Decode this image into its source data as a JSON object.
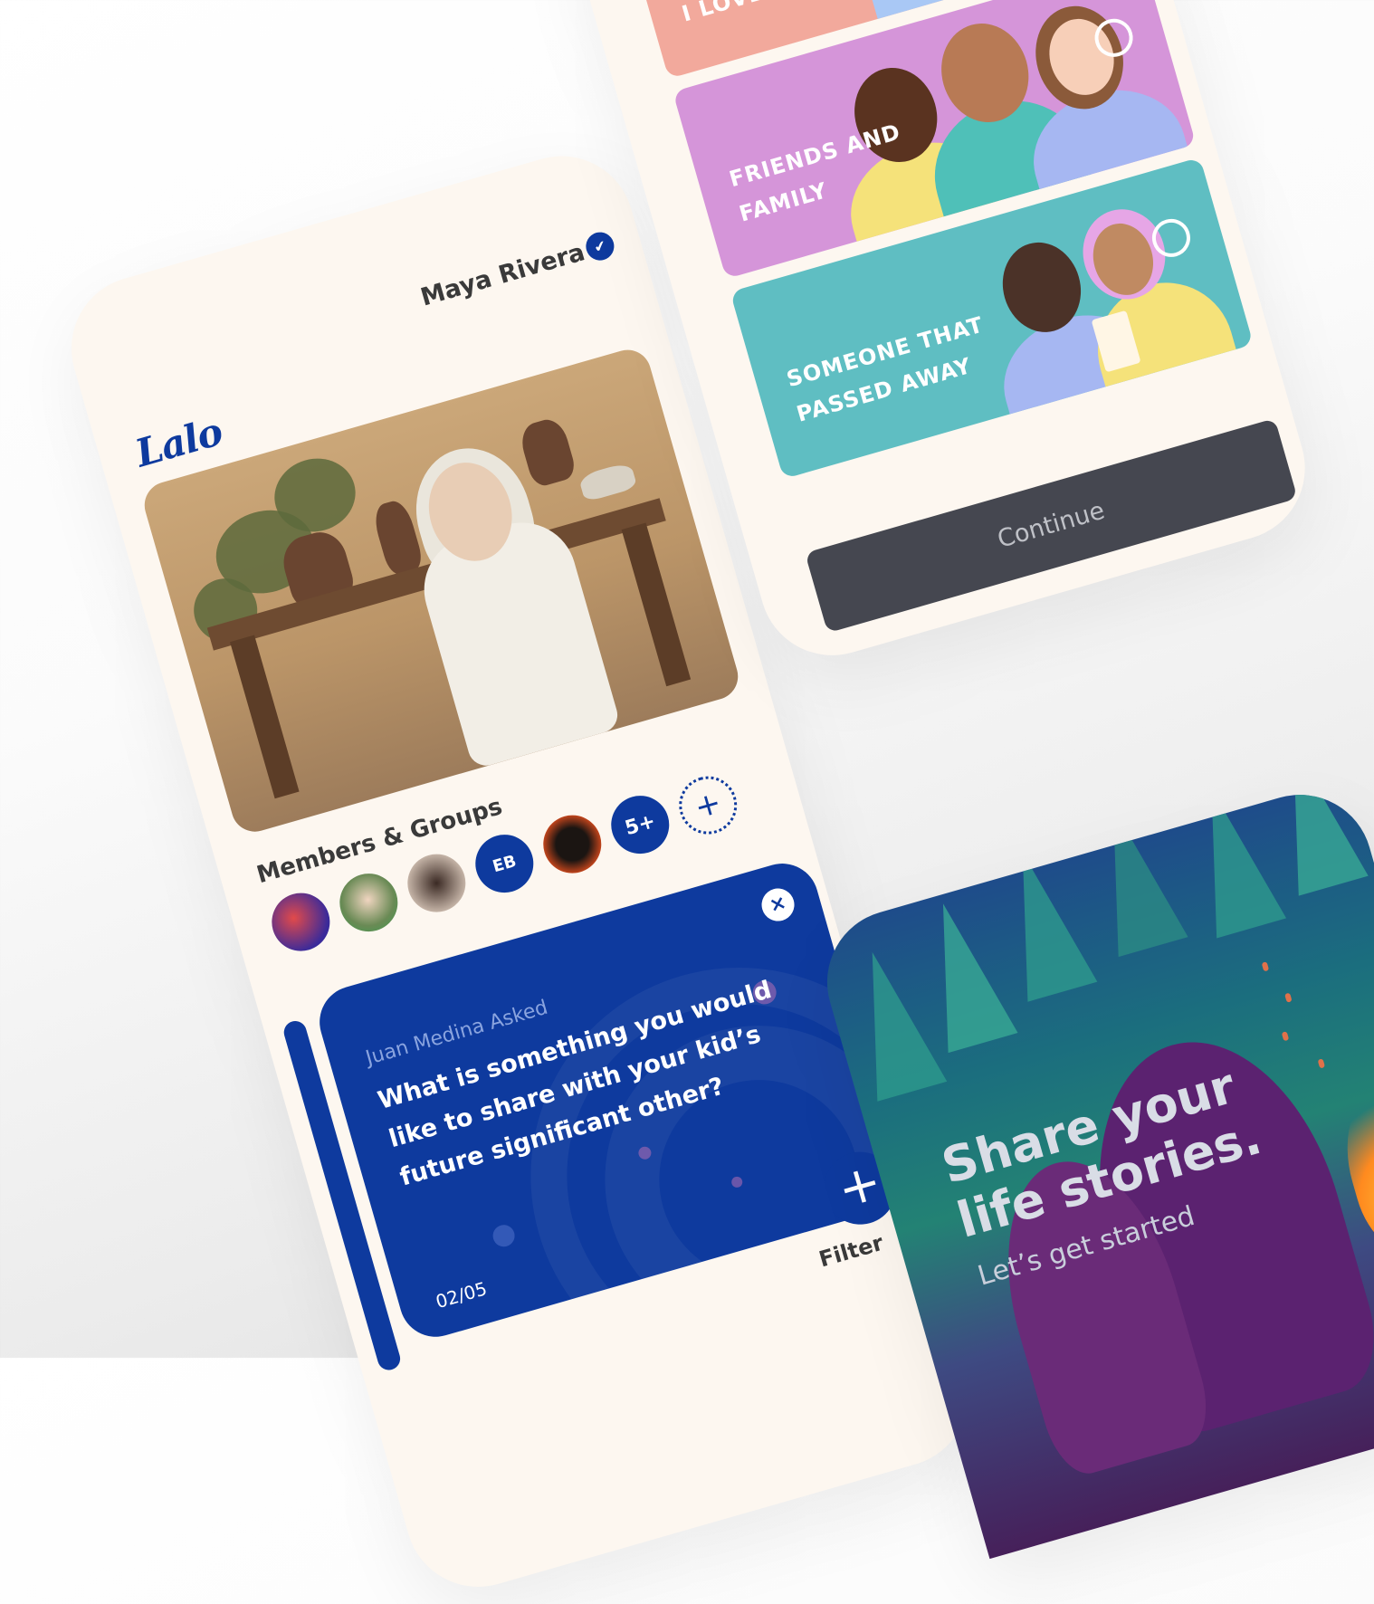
{
  "profile": {
    "name": "Maya Rivera",
    "verified_icon": "✔",
    "logo": "Lalo"
  },
  "members": {
    "title": "Members & Groups",
    "initials": "EB",
    "more_count": "5+",
    "add_icon": "+"
  },
  "question_card": {
    "asker": "Juan Medina Asked",
    "question": "What is something you would like to share with your kid’s future significant other?",
    "close_icon": "×",
    "pager": "02/05"
  },
  "actions": {
    "fab_icon": "+",
    "filter_label": "Filter"
  },
  "categories": [
    {
      "label": "I LOVE"
    },
    {
      "label": "FRIENDS AND FAMILY"
    },
    {
      "label": "SOMEONE THAT PASSED AWAY"
    }
  ],
  "continue_label": "Continue",
  "onboarding": {
    "headline": "Share your life stories.",
    "subline": "Let’s get started"
  },
  "colors": {
    "brand_blue": "#0e3a9e",
    "cream": "#fdf7f0",
    "button_dark": "#454750",
    "salmon": "#f2a99c",
    "lilac": "#d595d9",
    "teal": "#5fbec2"
  }
}
